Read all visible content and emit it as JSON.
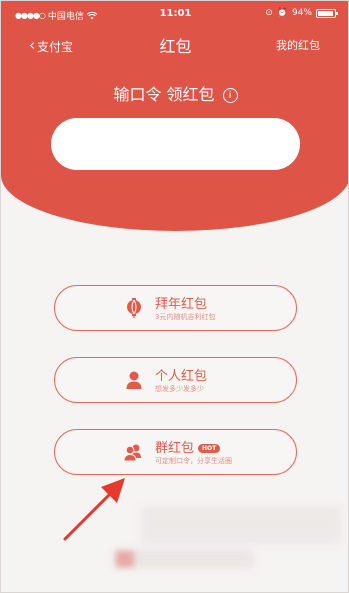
{
  "status_bar": {
    "carrier": "中国电信",
    "time": "11:01",
    "battery": "94%"
  },
  "nav": {
    "back_label": "支付宝",
    "title": "红包",
    "my_label": "我的红包"
  },
  "headline": {
    "text": "输口令 领红包",
    "info_glyph": "i"
  },
  "code_input": {
    "value": "",
    "placeholder": ""
  },
  "options": [
    {
      "title": "拜年红包",
      "subtitle": "3元内随机吉利红包",
      "icon": "lantern-icon"
    },
    {
      "title": "个人红包",
      "subtitle": "想发多少发多少",
      "icon": "person-icon"
    },
    {
      "title": "群红包",
      "badge": "HOT",
      "subtitle": "可定制口令，分享生活圈",
      "icon": "group-icon"
    }
  ],
  "colors": {
    "accent": "#de5548",
    "option_border": "#e5695c",
    "background": "#f6f4f2"
  }
}
